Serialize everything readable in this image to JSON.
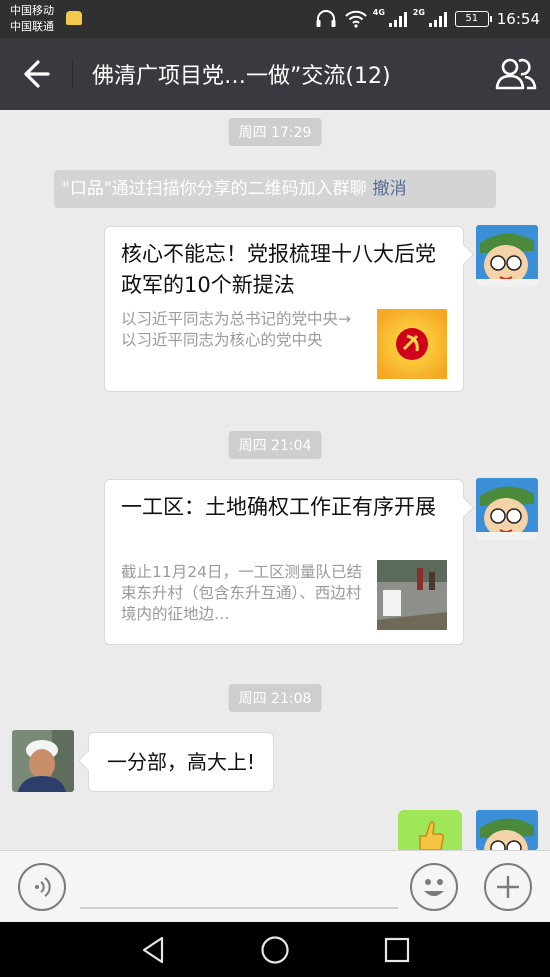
{
  "status_bar": {
    "carrier_1": "中国移动",
    "carrier_2": "中国联通",
    "network_1": "4G",
    "network_2": "2G",
    "battery": "51",
    "time": "16:54"
  },
  "header": {
    "title": "佛清广项目党…一做”交流(12)"
  },
  "messages": {
    "time_1": "周四 17:29",
    "system_notice": "\"口品\"通过扫描你分享的二维码加入群聊",
    "system_undo": "撤消",
    "card_1": {
      "title": "核心不能忘！党报梳理十八大后党政军的10个新提法",
      "desc": "以习近平同志为总书记的党中央→以习近平同志为核心的党中央"
    },
    "time_2": "周四 21:04",
    "card_2": {
      "title": "一工区：土地确权工作正有序开展",
      "desc": "截止11月24日，一工区测量队已结束东升村（包含东升互通）、西边村境内的征地边…"
    },
    "time_3": "周四 21:08",
    "text_message": "一分部，高大上!"
  },
  "colors": {
    "status_bar": "#303030",
    "title_bar": "#393a3f",
    "chat_bg": "#ebebeb",
    "sent_bubble": "#9fe658",
    "link": "#576b95"
  },
  "icons": {
    "back": "arrow-left-icon",
    "members": "group-members-icon",
    "voice": "voice-input-icon",
    "emoji": "emoji-icon",
    "plus": "plus-icon",
    "nav_back": "triangle-back-icon",
    "nav_home": "circle-home-icon",
    "nav_recent": "square-recent-icon"
  }
}
